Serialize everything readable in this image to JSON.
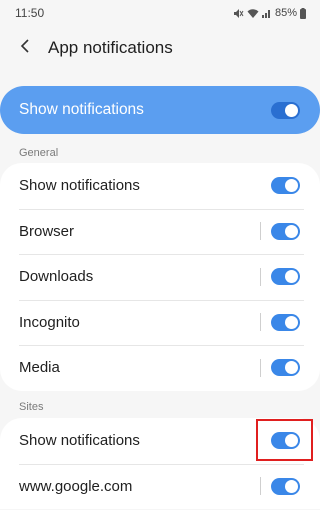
{
  "status_bar": {
    "time": "11:50",
    "battery": "85%"
  },
  "header": {
    "title": "App notifications"
  },
  "master": {
    "label": "Show notifications",
    "on": true
  },
  "sections": {
    "general": {
      "header": "General",
      "rows": [
        {
          "label": "Show notifications",
          "on": true,
          "divider": false
        },
        {
          "label": "Browser",
          "on": true,
          "divider": true
        },
        {
          "label": "Downloads",
          "on": true,
          "divider": true
        },
        {
          "label": "Incognito",
          "on": true,
          "divider": true
        },
        {
          "label": "Media",
          "on": true,
          "divider": true
        }
      ]
    },
    "sites": {
      "header": "Sites",
      "rows": [
        {
          "label": "Show notifications",
          "on": true,
          "divider": false
        },
        {
          "label": "www.google.com",
          "on": true,
          "divider": true
        }
      ]
    }
  },
  "colors": {
    "accent": "#3a87e8",
    "master_bg": "#5b9ef0",
    "highlight": "#e01f1f"
  }
}
